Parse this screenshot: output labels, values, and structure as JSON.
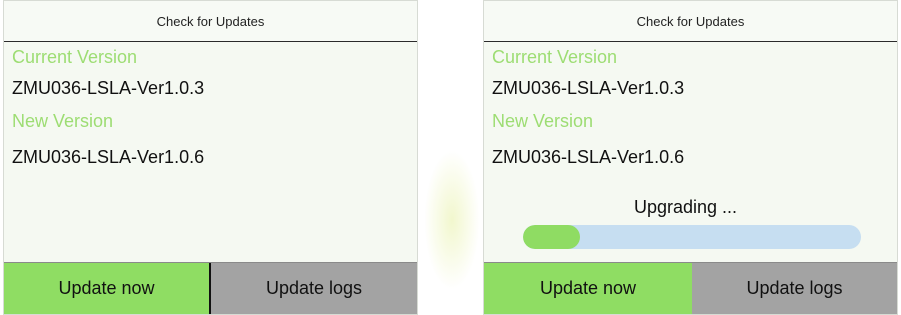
{
  "screens": [
    {
      "title": "Check for Updates",
      "current_version_label": "Current Version",
      "current_version": "ZMU036-LSLA-Ver1.0.3",
      "new_version_label": "New Version",
      "new_version": "ZMU036-LSLA-Ver1.0.6",
      "buttons": {
        "update_now": "Update now",
        "update_logs": "Update logs"
      }
    },
    {
      "title": "Check for Updates",
      "current_version_label": "Current Version",
      "current_version": "ZMU036-LSLA-Ver1.0.3",
      "new_version_label": "New Version",
      "new_version": "ZMU036-LSLA-Ver1.0.6",
      "status_text": "Upgrading ...",
      "progress_fraction": 0.17,
      "buttons": {
        "update_now": "Update now",
        "update_logs": "Update logs"
      }
    }
  ],
  "colors": {
    "accent_green": "#8fdd63",
    "label_green": "#9ddd73",
    "secondary_gray": "#a3a3a3",
    "progress_track": "#c6def1"
  }
}
